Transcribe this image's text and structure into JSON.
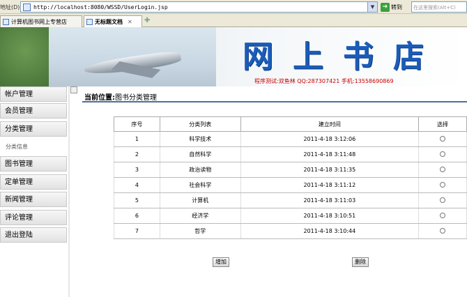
{
  "browser": {
    "address_label": "地址(D)",
    "url": "http://localhost:8080/WSSD/UserLogin.jsp",
    "go_label": "转到",
    "search_placeholder": "在这里搜索(Alt+C)",
    "tabs": [
      {
        "label": "计算机图书网上专营店",
        "active": false
      },
      {
        "label": "无标题文档",
        "active": true
      }
    ]
  },
  "banner": {
    "title": "网上书店",
    "info": "程序测试:双鱼林 QQ:287307421 手机:13558690869"
  },
  "menu": {
    "items": [
      {
        "label": "帐户管理"
      },
      {
        "label": "会员管理"
      },
      {
        "label": "分类管理"
      },
      {
        "label": "分类信息"
      },
      {
        "label": "图书管理"
      },
      {
        "label": "定单管理"
      },
      {
        "label": "新闻管理"
      },
      {
        "label": "评论管理"
      },
      {
        "label": "退出登陆"
      }
    ]
  },
  "main": {
    "crumb_prefix": "当前位置:",
    "crumb_page": "图书分类管理",
    "table": {
      "headers": [
        "序号",
        "分类列表",
        "建立时间",
        "选择"
      ],
      "rows": [
        {
          "no": "1",
          "name": "科学技术",
          "time": "2011-4-18 3:12:06"
        },
        {
          "no": "2",
          "name": "自然科学",
          "time": "2011-4-18 3:11:48"
        },
        {
          "no": "3",
          "name": "政治读物",
          "time": "2011-4-18 3:11:35"
        },
        {
          "no": "4",
          "name": "社会科学",
          "time": "2011-4-18 3:11:12"
        },
        {
          "no": "5",
          "name": "计算机",
          "time": "2011-4-18 3:11:03"
        },
        {
          "no": "6",
          "name": "经济学",
          "time": "2011-4-18 3:10:51"
        },
        {
          "no": "7",
          "name": "哲学",
          "time": "2011-4-18 3:10:44"
        }
      ]
    },
    "add_label": "增加",
    "delete_label": "删除"
  }
}
